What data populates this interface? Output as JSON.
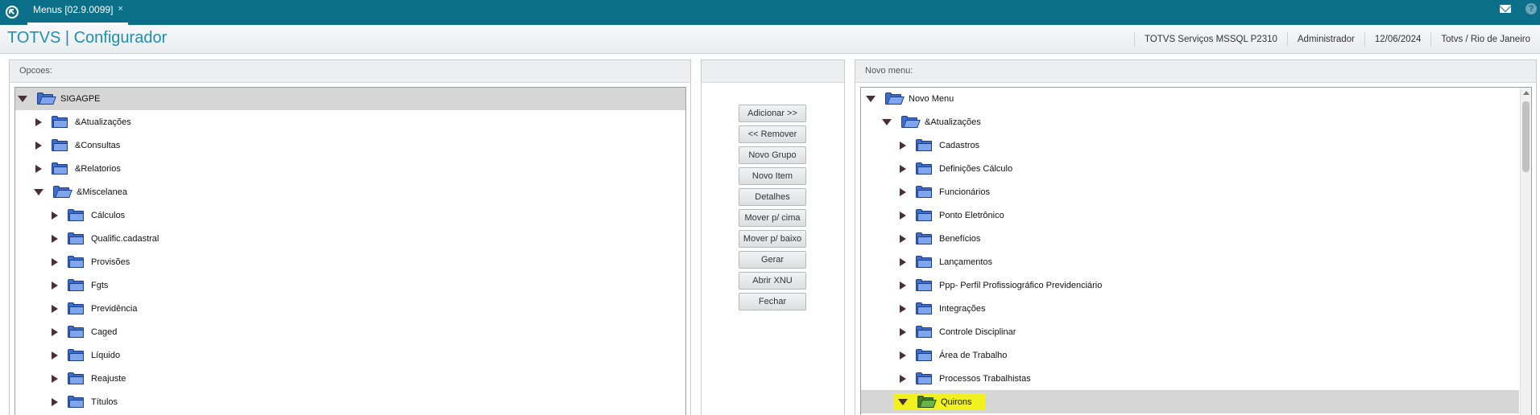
{
  "topbar": {
    "tab_label": "Menus [02.9.0099]",
    "tab_close": "×",
    "help_label": "?"
  },
  "header": {
    "title": "TOTVS | Configurador",
    "info": [
      "TOTVS Serviços MSSQL P2310",
      "Administrador",
      "12/06/2024",
      "Totvs / Rio de Janeiro"
    ]
  },
  "left_panel": {
    "title": "Opcoes:",
    "items": [
      {
        "label": "SIGAGPE",
        "level": 0,
        "expanded": true,
        "selected": true
      },
      {
        "label": "&Atualizações",
        "level": 1,
        "expanded": false
      },
      {
        "label": "&Consultas",
        "level": 1,
        "expanded": false
      },
      {
        "label": "&Relatorios",
        "level": 1,
        "expanded": false
      },
      {
        "label": "&Miscelanea",
        "level": 1,
        "expanded": true
      },
      {
        "label": "Cálculos",
        "level": 2,
        "expanded": false
      },
      {
        "label": "Qualific.cadastral",
        "level": 2,
        "expanded": false
      },
      {
        "label": "Provisões",
        "level": 2,
        "expanded": false
      },
      {
        "label": "Fgts",
        "level": 2,
        "expanded": false
      },
      {
        "label": "Previdência",
        "level": 2,
        "expanded": false
      },
      {
        "label": "Caged",
        "level": 2,
        "expanded": false
      },
      {
        "label": "Líquido",
        "level": 2,
        "expanded": false
      },
      {
        "label": "Reajuste",
        "level": 2,
        "expanded": false
      },
      {
        "label": "Títulos",
        "level": 2,
        "expanded": false
      }
    ]
  },
  "buttons": [
    {
      "name": "adicionar-button",
      "label": "Adicionar >>"
    },
    {
      "name": "remover-button",
      "label": "<< Remover"
    },
    {
      "name": "novo-grupo-button",
      "label": "Novo Grupo"
    },
    {
      "name": "novo-item-button",
      "label": "Novo Item"
    },
    {
      "name": "detalhes-button",
      "label": "Detalhes"
    },
    {
      "name": "mover-cima-button",
      "label": "Mover p/ cima"
    },
    {
      "name": "mover-baixo-button",
      "label": "Mover p/ baixo"
    },
    {
      "name": "gerar-button",
      "label": "Gerar"
    },
    {
      "name": "abrir-xnu-button",
      "label": "Abrir XNU"
    },
    {
      "name": "fechar-button",
      "label": "Fechar"
    }
  ],
  "right_panel": {
    "title": "Novo menu:",
    "items": [
      {
        "label": "Novo Menu",
        "level": 0,
        "expanded": true
      },
      {
        "label": "&Atualizações",
        "level": 1,
        "expanded": true
      },
      {
        "label": "Cadastros",
        "level": 2,
        "expanded": false
      },
      {
        "label": "Definições Cálculo",
        "level": 2,
        "expanded": false
      },
      {
        "label": "Funcionários",
        "level": 2,
        "expanded": false
      },
      {
        "label": "Ponto Eletrônico",
        "level": 2,
        "expanded": false
      },
      {
        "label": "Benefícios",
        "level": 2,
        "expanded": false
      },
      {
        "label": "Lançamentos",
        "level": 2,
        "expanded": false
      },
      {
        "label": "Ppp- Perfil Profissiográfico Previdenciário",
        "level": 2,
        "expanded": false
      },
      {
        "label": "Integrações",
        "level": 2,
        "expanded": false
      },
      {
        "label": "Controle Disciplinar",
        "level": 2,
        "expanded": false
      },
      {
        "label": "Área de Trabalho",
        "level": 2,
        "expanded": false
      },
      {
        "label": "Processos Trabalhistas",
        "level": 2,
        "expanded": false
      },
      {
        "label": "Quirons",
        "level": 2,
        "expanded": true,
        "selected": true,
        "highlighted": true
      }
    ]
  },
  "colors": {
    "topbar": "#0b6f8a",
    "title": "#1f8fb4",
    "highlight": "#f1f120",
    "folder_blue": "#3d6ec9",
    "folder_green": "#3f7c22"
  }
}
